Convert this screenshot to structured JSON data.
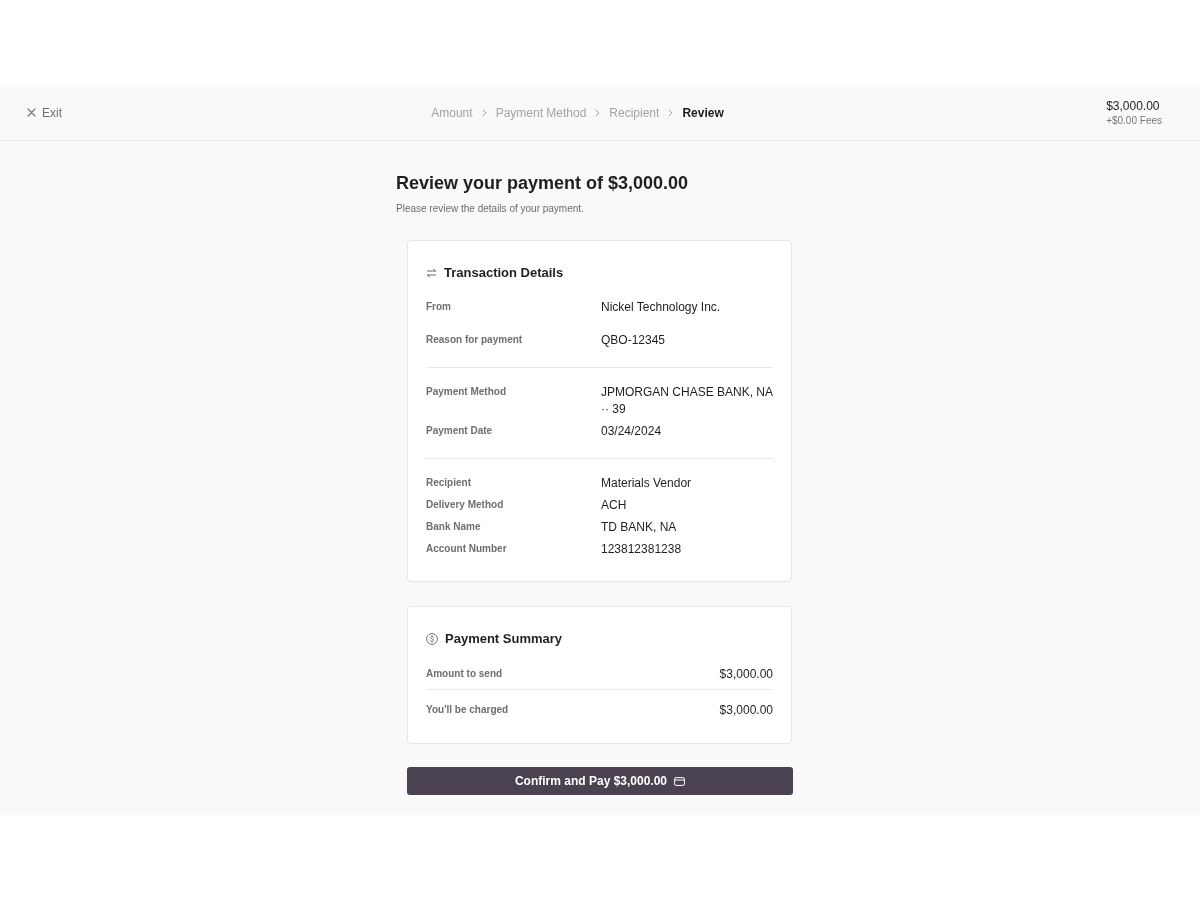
{
  "header": {
    "exit_label": "Exit",
    "steps": [
      {
        "label": "Amount",
        "selected": false
      },
      {
        "label": "Payment Method",
        "selected": false
      },
      {
        "label": "Recipient",
        "selected": false
      },
      {
        "label": "Review",
        "selected": true
      }
    ],
    "total": "$3,000.00",
    "fees": "+$0.00 Fees"
  },
  "title": "Review your payment of $3,000.00",
  "subtitle": "Please review the details of your payment.",
  "transaction_details": {
    "title": "Transaction Details",
    "groups": [
      {
        "rows": [
          {
            "label": "From",
            "value": "Nickel Technology Inc."
          },
          {
            "label": "Reason for payment",
            "value": "QBO-12345"
          }
        ]
      },
      {
        "rows": [
          {
            "label": "Payment Method",
            "value": "JPMORGAN CHASE BANK, NA ·· 39"
          },
          {
            "label": "Payment Date",
            "value": "03/24/2024"
          }
        ]
      },
      {
        "rows": [
          {
            "label": "Recipient",
            "value": "Materials Vendor"
          },
          {
            "label": "Delivery Method",
            "value": "ACH"
          },
          {
            "label": "Bank Name",
            "value": "TD BANK, NA"
          },
          {
            "label": "Account Number",
            "value": "123812381238"
          }
        ]
      }
    ]
  },
  "payment_summary": {
    "title": "Payment Summary",
    "rows": [
      {
        "label": "Amount to send",
        "value": "$3,000.00"
      },
      {
        "label": "You'll be charged",
        "value": "$3,000.00"
      }
    ]
  },
  "confirm_button": {
    "label": "Confirm and Pay $3,000.00"
  }
}
